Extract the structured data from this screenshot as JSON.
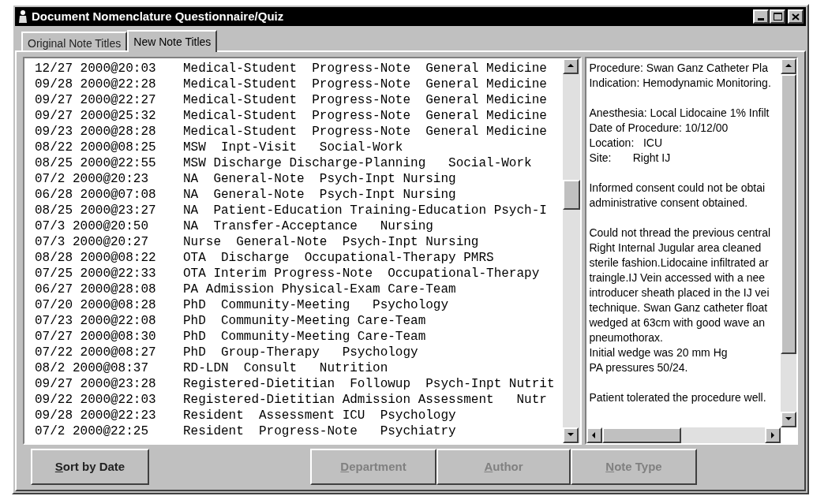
{
  "window": {
    "title": "Document Nomenclature Questionnaire/Quiz"
  },
  "tabs": [
    {
      "label": "Original Note Titles",
      "selected": false
    },
    {
      "label": "New Note Titles",
      "selected": true
    }
  ],
  "notes": [
    {
      "date": "12/27 2000@20:03",
      "title": "Medical-Student  Progress-Note  General Medicine"
    },
    {
      "date": "09/28 2000@22:28",
      "title": "Medical-Student  Progress-Note  General Medicine"
    },
    {
      "date": "09/27 2000@22:27",
      "title": "Medical-Student  Progress-Note  General Medicine"
    },
    {
      "date": "09/27 2000@25:32",
      "title": "Medical-Student  Progress-Note  General Medicine"
    },
    {
      "date": "09/23 2000@28:28",
      "title": "Medical-Student  Progress-Note  General Medicine"
    },
    {
      "date": "08/22 2000@08:25",
      "title": "MSW  Inpt-Visit   Social-Work"
    },
    {
      "date": "08/25 2000@22:55",
      "title": "MSW Discharge Discharge-Planning   Social-Work"
    },
    {
      "date": "07/2 2000@20:23",
      "title": "NA  General-Note  Psych-Inpt Nursing"
    },
    {
      "date": "06/28 2000@07:08",
      "title": "NA  General-Note  Psych-Inpt Nursing"
    },
    {
      "date": "08/25 2000@23:27",
      "title": "NA  Patient-Education Training-Education Psych-I"
    },
    {
      "date": "07/3 2000@20:50",
      "title": "NA  Transfer-Acceptance   Nursing"
    },
    {
      "date": "07/3 2000@20:27",
      "title": "Nurse  General-Note  Psych-Inpt Nursing"
    },
    {
      "date": "08/28 2000@08:22",
      "title": "OTA  Discharge  Occupational-Therapy PMRS"
    },
    {
      "date": "07/25 2000@22:33",
      "title": "OTA Interim Progress-Note  Occupational-Therapy"
    },
    {
      "date": "06/27 2000@28:08",
      "title": "PA Admission Physical-Exam Care-Team"
    },
    {
      "date": "07/20 2000@08:28",
      "title": "PhD  Community-Meeting   Psychology"
    },
    {
      "date": "07/23 2000@22:08",
      "title": "PhD  Community-Meeting Care-Team"
    },
    {
      "date": "07/27 2000@08:30",
      "title": "PhD  Community-Meeting Care-Team"
    },
    {
      "date": "07/22 2000@08:27",
      "title": "PhD  Group-Therapy   Psychology"
    },
    {
      "date": "08/2 2000@08:37",
      "title": "RD-LDN  Consult   Nutrition"
    },
    {
      "date": "09/27 2000@23:28",
      "title": "Registered-Dietitian  Followup  Psych-Inpt Nutrit"
    },
    {
      "date": "09/22 2000@22:03",
      "title": "Registered-Dietitian Admission Assessment   Nutr"
    },
    {
      "date": "09/28 2000@22:23",
      "title": "Resident  Assessment ICU  Psychology"
    },
    {
      "date": "07/2 2000@22:25",
      "title": "Resident  Progress-Note   Psychiatry"
    }
  ],
  "note_text": [
    [
      "Procedure: Swan Ganz Catheter Pla",
      "Indication: Hemodynamic Monitoring."
    ],
    [
      "Anesthesia: Local Lidocaine 1% Infilt",
      "Date of Procedure: 10/12/00",
      "Location:   ICU",
      "Site:       Right IJ"
    ],
    [
      "Informed consent could not be obtai",
      "administrative consent obtained."
    ],
    [
      "Could not thread the previous central",
      "Right Internal Jugular area cleaned",
      "sterile fashion.Lidocaine infiltrated ar",
      "traingle.IJ Vein accessed with a nee",
      "introducer sheath placed in the IJ vei",
      "technique. Swan Ganz catheter float",
      "wedged at 63cm with good wave an",
      "pneumothorax.",
      "Initial wedge was 20 mm Hg",
      "PA pressures 50/24."
    ],
    [
      "Patient tolerated the procedure well."
    ]
  ],
  "buttons": [
    {
      "label": "Sort by Date",
      "disabled": false
    },
    {
      "label": "Department",
      "disabled": true
    },
    {
      "label": "Author",
      "disabled": true
    },
    {
      "label": "Note Type",
      "disabled": true
    }
  ]
}
